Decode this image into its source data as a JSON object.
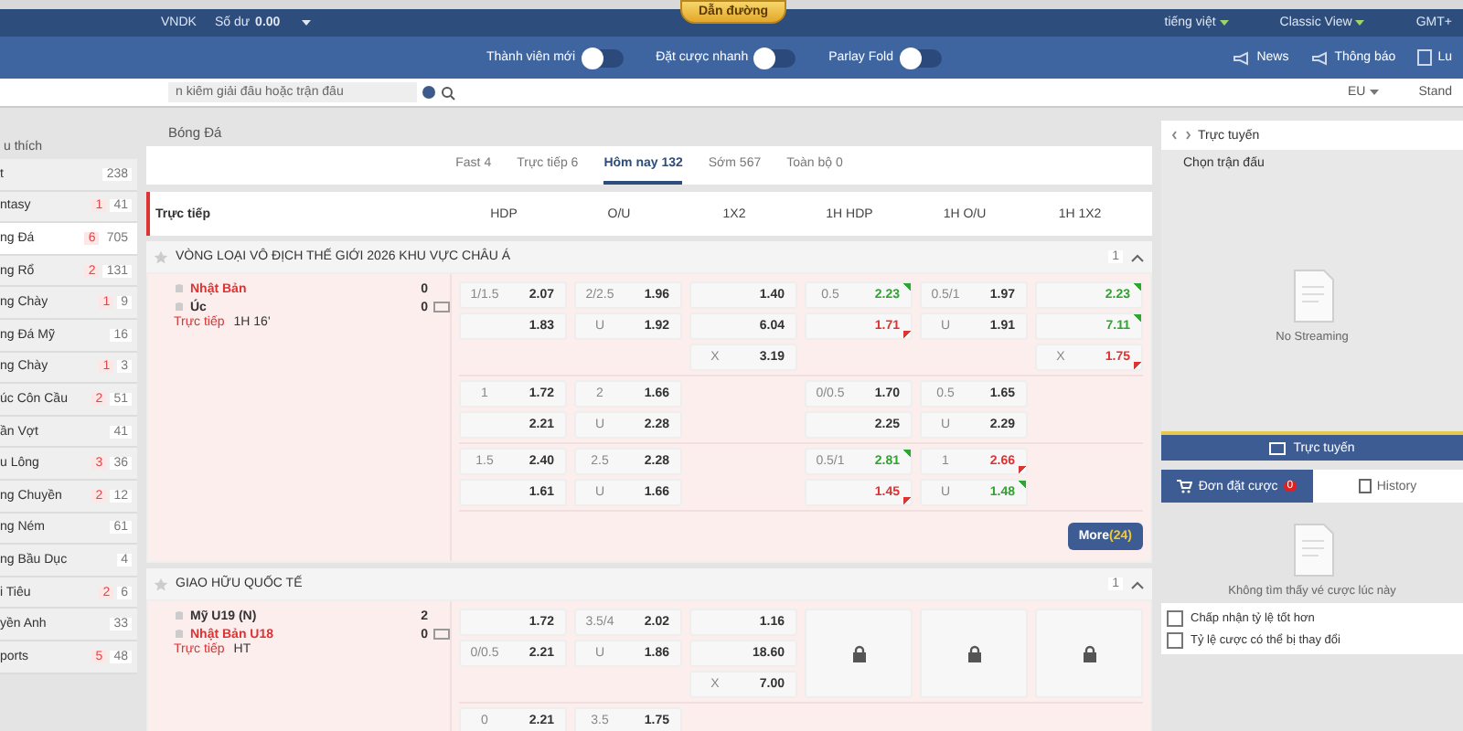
{
  "top_bar": {
    "currency": "VNDK",
    "balance_label": "Số dư",
    "balance": "0.00",
    "guide_badge": "Dẫn đường",
    "language": "tiếng việt",
    "view": "Classic View",
    "timezone": "GMT+"
  },
  "toolbar": {
    "toggles": [
      {
        "label": "Thành viên mới",
        "on": false
      },
      {
        "label": "Đặt cược nhanh",
        "on": false
      },
      {
        "label": "Parlay Fold",
        "on": false
      }
    ],
    "links": [
      {
        "kind": "news",
        "label": "News"
      },
      {
        "kind": "notice",
        "label": "Thông báo"
      },
      {
        "kind": "rules",
        "label": "Lu"
      }
    ]
  },
  "search": {
    "placeholder": "n kiếm giải đấu hoặc trận đấu"
  },
  "odds_format": "EU",
  "view_mode": "Stand",
  "sidebar": {
    "heading": "u thích",
    "items": [
      {
        "label": "t",
        "total": "238",
        "selected": false
      },
      {
        "label": "ntasy",
        "live": "1",
        "total": "41",
        "selected": false
      },
      {
        "label": "ng Đá",
        "live": "6",
        "total": "705",
        "selected": true
      },
      {
        "label": "ng Rổ",
        "live": "2",
        "total": "131",
        "selected": false
      },
      {
        "label": "ng Chày",
        "live": "1",
        "total": "9",
        "selected": false
      },
      {
        "label": "ng Đá Mỹ",
        "total": "16",
        "selected": false
      },
      {
        "label": "ng Chày",
        "live": "1",
        "total": "3",
        "selected": false
      },
      {
        "label": "úc Côn Cầu",
        "live": "2",
        "total": "51",
        "selected": false
      },
      {
        "label": "ần Vợt",
        "total": "41",
        "selected": false
      },
      {
        "label": "u Lông",
        "live": "3",
        "total": "36",
        "selected": false
      },
      {
        "label": "ng Chuyền",
        "live": "2",
        "total": "12",
        "selected": false
      },
      {
        "label": "ng Ném",
        "total": "61",
        "selected": false
      },
      {
        "label": "ng Bầu Dục",
        "total": "4",
        "selected": false
      },
      {
        "label": "i Tiêu",
        "live": "2",
        "total": "6",
        "selected": false
      },
      {
        "label": "yền Anh",
        "total": "33",
        "selected": false
      },
      {
        "label": "ports",
        "live": "5",
        "total": "48",
        "selected": false
      }
    ]
  },
  "breadcrumb": "Bóng Đá",
  "tabs": [
    {
      "label": "Fast 4",
      "selected": false
    },
    {
      "label": "Trực tiếp 6",
      "selected": false
    },
    {
      "label": "Hôm nay 132",
      "selected": true
    },
    {
      "label": "Sớm 567",
      "selected": false
    },
    {
      "label": "Toàn bộ 0",
      "selected": false
    }
  ],
  "table": {
    "section": "Trực tiếp",
    "columns": [
      "HDP",
      "O/U",
      "1X2",
      "1H HDP",
      "1H O/U",
      "1H 1X2"
    ]
  },
  "leagues": [
    {
      "name": "VÒNG LOẠI VÔ ĐỊCH THẾ GIỚI 2026 KHU VỰC CHÂU Á",
      "count": "1",
      "more": {
        "label": "More",
        "count": "(24)"
      },
      "matches": [
        {
          "teams": [
            {
              "name": "Nhật Bản",
              "score": "0",
              "highlighted": true
            },
            {
              "name": "Úc",
              "score": "0",
              "highlighted": false
            }
          ],
          "status": "Trực tiếp",
          "time": "1H 16'",
          "lines": [
            [
              {
                "kind": "odds",
                "rows": [
                  {
                    "kind": "plain",
                    "label": "1/1.5",
                    "odd": "2.07"
                  },
                  {
                    "kind": "plain",
                    "odd": "1.83"
                  }
                ]
              },
              {
                "kind": "odds",
                "rows": [
                  {
                    "kind": "plain",
                    "label": "2/2.5",
                    "odd": "1.96"
                  },
                  {
                    "kind": "plain",
                    "label": "U",
                    "odd": "1.92"
                  }
                ]
              },
              {
                "kind": "odds",
                "rows": [
                  {
                    "kind": "plain",
                    "odd": "1.40"
                  },
                  {
                    "kind": "plain",
                    "odd": "6.04"
                  },
                  {
                    "kind": "plain",
                    "label": "X",
                    "odd": "3.19"
                  }
                ]
              },
              {
                "kind": "odds",
                "rows": [
                  {
                    "kind": "rising",
                    "label": "0.5",
                    "odd": "2.23"
                  },
                  {
                    "kind": "falling",
                    "odd": "1.71"
                  }
                ]
              },
              {
                "kind": "odds",
                "rows": [
                  {
                    "kind": "plain",
                    "label": "0.5/1",
                    "odd": "1.97"
                  },
                  {
                    "kind": "plain",
                    "label": "U",
                    "odd": "1.91"
                  }
                ]
              },
              {
                "kind": "odds",
                "rows": [
                  {
                    "kind": "rising",
                    "odd": "2.23"
                  },
                  {
                    "kind": "rising",
                    "odd": "7.11"
                  },
                  {
                    "kind": "falling",
                    "label": "X",
                    "odd": "1.75"
                  }
                ]
              }
            ],
            [
              {
                "kind": "odds",
                "rows": [
                  {
                    "kind": "plain",
                    "label": "1",
                    "odd": "1.72"
                  },
                  {
                    "kind": "plain",
                    "odd": "2.21"
                  }
                ]
              },
              {
                "kind": "odds",
                "rows": [
                  {
                    "kind": "plain",
                    "label": "2",
                    "odd": "1.66"
                  },
                  {
                    "kind": "plain",
                    "label": "U",
                    "odd": "2.28"
                  }
                ]
              },
              {
                "kind": "empty"
              },
              {
                "kind": "odds",
                "rows": [
                  {
                    "kind": "plain",
                    "label": "0/0.5",
                    "odd": "1.70"
                  },
                  {
                    "kind": "plain",
                    "odd": "2.25"
                  }
                ]
              },
              {
                "kind": "odds",
                "rows": [
                  {
                    "kind": "plain",
                    "label": "0.5",
                    "odd": "1.65"
                  },
                  {
                    "kind": "plain",
                    "label": "U",
                    "odd": "2.29"
                  }
                ]
              },
              {
                "kind": "empty"
              }
            ],
            [
              {
                "kind": "odds",
                "rows": [
                  {
                    "kind": "plain",
                    "label": "1.5",
                    "odd": "2.40"
                  },
                  {
                    "kind": "plain",
                    "odd": "1.61"
                  }
                ]
              },
              {
                "kind": "odds",
                "rows": [
                  {
                    "kind": "plain",
                    "label": "2.5",
                    "odd": "2.28"
                  },
                  {
                    "kind": "plain",
                    "label": "U",
                    "odd": "1.66"
                  }
                ]
              },
              {
                "kind": "empty"
              },
              {
                "kind": "odds",
                "rows": [
                  {
                    "kind": "rising",
                    "label": "0.5/1",
                    "odd": "2.81"
                  },
                  {
                    "kind": "falling",
                    "odd": "1.45"
                  }
                ]
              },
              {
                "kind": "odds",
                "rows": [
                  {
                    "kind": "falling",
                    "label": "1",
                    "odd": "2.66"
                  },
                  {
                    "kind": "rising",
                    "label": "U",
                    "odd": "1.48"
                  }
                ]
              },
              {
                "kind": "empty"
              }
            ]
          ]
        }
      ]
    },
    {
      "name": "GIAO HỮU QUỐC TẾ",
      "count": "1",
      "matches": [
        {
          "teams": [
            {
              "name": "Mỹ U19 (N)",
              "score": "2",
              "highlighted": false
            },
            {
              "name": "Nhật Bản U18",
              "score": "0",
              "highlighted": true
            }
          ],
          "status": "Trực tiếp",
          "time": "HT",
          "lines": [
            [
              {
                "kind": "odds",
                "rows": [
                  {
                    "kind": "plain",
                    "odd": "1.72"
                  },
                  {
                    "kind": "plain",
                    "label": "0/0.5",
                    "odd": "2.21"
                  }
                ]
              },
              {
                "kind": "odds",
                "rows": [
                  {
                    "kind": "plain",
                    "label": "3.5/4",
                    "odd": "2.02"
                  },
                  {
                    "kind": "plain",
                    "label": "U",
                    "odd": "1.86"
                  }
                ]
              },
              {
                "kind": "odds",
                "rows": [
                  {
                    "kind": "plain",
                    "odd": "1.16"
                  },
                  {
                    "kind": "plain",
                    "odd": "18.60"
                  },
                  {
                    "kind": "plain",
                    "label": "X",
                    "odd": "7.00"
                  }
                ]
              },
              {
                "kind": "locked"
              },
              {
                "kind": "locked"
              },
              {
                "kind": "locked"
              }
            ],
            [
              {
                "kind": "odds",
                "rows": [
                  {
                    "kind": "plain",
                    "label": "0",
                    "odd": "2.21"
                  }
                ]
              },
              {
                "kind": "odds",
                "rows": [
                  {
                    "kind": "plain",
                    "label": "3.5",
                    "odd": "1.75"
                  }
                ]
              },
              {
                "kind": "empty"
              },
              {
                "kind": "empty"
              },
              {
                "kind": "empty"
              },
              {
                "kind": "empty"
              }
            ]
          ]
        }
      ]
    }
  ],
  "stream_panel": {
    "title": "Trực tuyến",
    "select_label": "Chọn trận đấu",
    "empty_text": "No Streaming",
    "button": "Trực tuyến"
  },
  "bet_slip": {
    "tabs": [
      {
        "label": "Đơn đặt cược",
        "badge": "0",
        "selected": true
      },
      {
        "label": "History",
        "selected": false
      }
    ],
    "empty_text": "Không tìm thấy vé cược lúc này",
    "options": [
      {
        "label": "Chấp nhận tỷ lệ tốt hơn",
        "checked": false
      },
      {
        "label": "Tỷ lệ cược có thể bị thay đổi",
        "checked": false
      }
    ]
  }
}
